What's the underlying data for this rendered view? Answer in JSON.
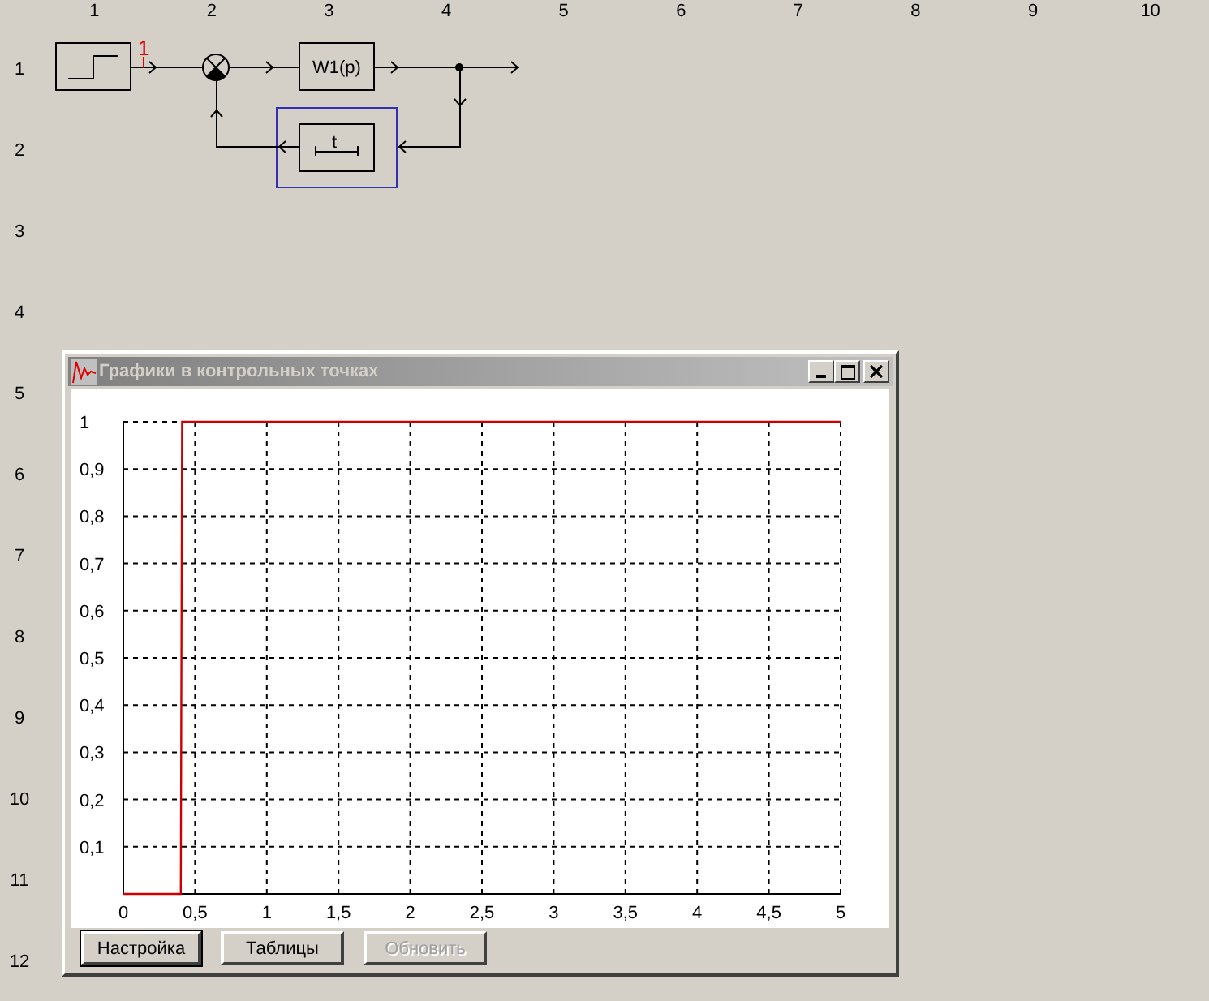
{
  "grid": {
    "columns": [
      "1",
      "2",
      "3",
      "4",
      "5",
      "6",
      "7",
      "8",
      "9",
      "10"
    ],
    "rows": [
      "1",
      "2",
      "3",
      "4",
      "5",
      "6",
      "7",
      "8",
      "9",
      "10",
      "11",
      "12"
    ]
  },
  "diagram": {
    "probe_label": "1",
    "transfer_label": "W1(p)",
    "delay_label": "t",
    "delay_selected": true
  },
  "window": {
    "title": "Графики в контрольных точках",
    "chart_data": {
      "type": "line",
      "x": [
        0,
        0.4,
        0.41,
        5
      ],
      "series": [
        {
          "color": "#cc0000",
          "values": [
            0,
            0,
            1,
            1
          ]
        }
      ],
      "grid": true,
      "xlim": [
        0,
        5
      ],
      "ylim": [
        0,
        1
      ],
      "xticks": [
        {
          "value": 0,
          "label": "0"
        },
        {
          "value": 0.5,
          "label": "0,5"
        },
        {
          "value": 1,
          "label": "1"
        },
        {
          "value": 1.5,
          "label": "1,5"
        },
        {
          "value": 2,
          "label": "2"
        },
        {
          "value": 2.5,
          "label": "2,5"
        },
        {
          "value": 3,
          "label": "3"
        },
        {
          "value": 3.5,
          "label": "3,5"
        },
        {
          "value": 4,
          "label": "4"
        },
        {
          "value": 4.5,
          "label": "4,5"
        },
        {
          "value": 5,
          "label": "5"
        }
      ],
      "yticks": [
        {
          "value": 0.1,
          "label": "0,1"
        },
        {
          "value": 0.2,
          "label": "0,2"
        },
        {
          "value": 0.3,
          "label": "0,3"
        },
        {
          "value": 0.4,
          "label": "0,4"
        },
        {
          "value": 0.5,
          "label": "0,5"
        },
        {
          "value": 0.6,
          "label": "0,6"
        },
        {
          "value": 0.7,
          "label": "0,7"
        },
        {
          "value": 0.8,
          "label": "0,8"
        },
        {
          "value": 0.9,
          "label": "0,9"
        },
        {
          "value": 1,
          "label": "1"
        }
      ]
    },
    "buttons": [
      {
        "label": "Настройка",
        "default": true,
        "disabled": false
      },
      {
        "label": "Таблицы",
        "default": false,
        "disabled": false
      },
      {
        "label": "Обновить",
        "default": false,
        "disabled": true
      }
    ]
  }
}
